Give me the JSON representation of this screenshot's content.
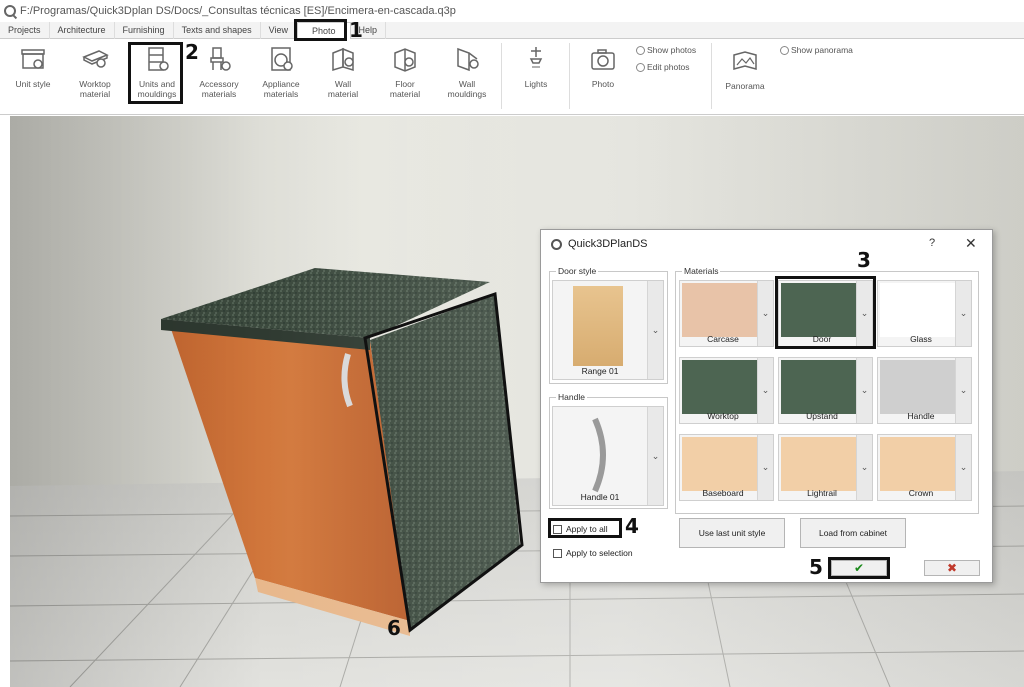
{
  "window": {
    "title": "F:/Programas/Quick3Dplan DS/Docs/_Consultas técnicas [ES]/Encimera-en-cascada.q3p"
  },
  "tabs": [
    {
      "label": "Projects"
    },
    {
      "label": "Architecture"
    },
    {
      "label": "Furnishing"
    },
    {
      "label": "Texts and shapes"
    },
    {
      "label": "View"
    },
    {
      "label": "Photo"
    },
    {
      "label": "Help"
    }
  ],
  "ribbon": {
    "buttons": [
      {
        "label": "Unit style",
        "icon": "unit-style-icon"
      },
      {
        "label": "Worktop\nmaterial",
        "icon": "worktop-icon"
      },
      {
        "label": "Units and\nmouldings",
        "icon": "units-icon"
      },
      {
        "label": "Accessory\nmaterials",
        "icon": "accessory-icon"
      },
      {
        "label": "Appliance\nmaterials",
        "icon": "appliance-icon"
      },
      {
        "label": "Wall\nmaterial",
        "icon": "wall-icon"
      },
      {
        "label": "Floor\nmaterial",
        "icon": "floor-icon"
      },
      {
        "label": "Wall\nmouldings",
        "icon": "wall-mouldings-icon"
      },
      {
        "label": "Lights",
        "icon": "lights-icon"
      },
      {
        "label": "Photo",
        "icon": "camera-icon"
      },
      {
        "label": "Panorama",
        "icon": "panorama-icon"
      }
    ],
    "options": {
      "show_photos": "Show photos",
      "edit_photos": "Edit photos",
      "show_panorama": "Show panorama"
    }
  },
  "callouts": {
    "n1": "1",
    "n2": "2",
    "n3": "3",
    "n4": "4",
    "n5": "5",
    "n6": "6"
  },
  "dialog": {
    "title": "Quick3DPlanDS",
    "help": "?",
    "close": "✕",
    "door_style": {
      "group": "Door style",
      "value": "Range 01"
    },
    "handle": {
      "group": "Handle",
      "value": "Handle 01"
    },
    "materials": {
      "group": "Materials",
      "items": [
        {
          "label": "Carcase",
          "color": "#e8c3a8"
        },
        {
          "label": "Door",
          "color": "#4d6552"
        },
        {
          "label": "Glass",
          "color": "#ffffff"
        },
        {
          "label": "Worktop",
          "color": "#4d6552"
        },
        {
          "label": "Upstand",
          "color": "#4d6552"
        },
        {
          "label": "Handle",
          "color": "#cfcfcf"
        },
        {
          "label": "Baseboard",
          "color": "#f2cfa7"
        },
        {
          "label": "Lightrail",
          "color": "#f2cfa7"
        },
        {
          "label": "Crown",
          "color": "#f2cfa7"
        }
      ]
    },
    "apply_to_all": "Apply to all",
    "apply_to_selection": "Apply to selection",
    "use_last_unit_style": "Use last unit style",
    "load_from_cabinet": "Load from cabinet",
    "ok_symbol": "✔",
    "cancel_symbol": "✖"
  }
}
